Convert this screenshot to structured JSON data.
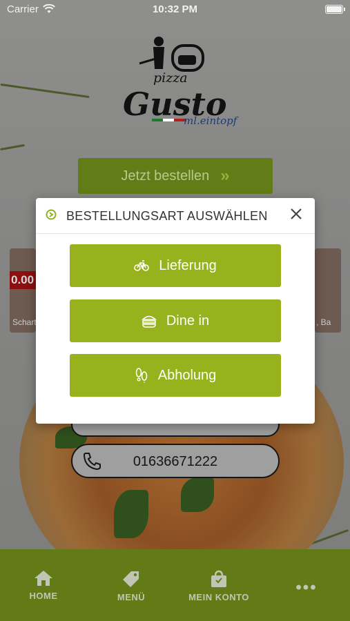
{
  "status_bar": {
    "carrier": "Carrier",
    "time": "10:32 PM"
  },
  "brand": {
    "logo_pizza": "pizza",
    "logo_name": "Gusto",
    "logo_tagline": "ml.eintopf"
  },
  "main": {
    "order_now_label": "Jetzt bestellen",
    "phone_number": "01636671222"
  },
  "background_cards": {
    "price_fragment": "0.00",
    "left_caption": "Schart",
    "right_caption": ", Ba"
  },
  "modal": {
    "title": "BESTELLUNGSART AUSWÄHLEN",
    "options": [
      {
        "label": "Lieferung",
        "icon": "bicycle-icon"
      },
      {
        "label": "Dine in",
        "icon": "food-icon"
      },
      {
        "label": "Abholung",
        "icon": "footprints-icon"
      }
    ]
  },
  "tab_bar": {
    "items": [
      {
        "label": "HOME",
        "icon": "home-icon"
      },
      {
        "label": "MENÜ",
        "icon": "tag-icon"
      },
      {
        "label": "MEIN KONTO",
        "icon": "bag-icon"
      },
      {
        "label": "•••",
        "icon": "more-icon"
      }
    ]
  },
  "colors": {
    "accent_green": "#97b21c",
    "tab_bar_green": "#627b16",
    "dark_button": "#627c17"
  }
}
